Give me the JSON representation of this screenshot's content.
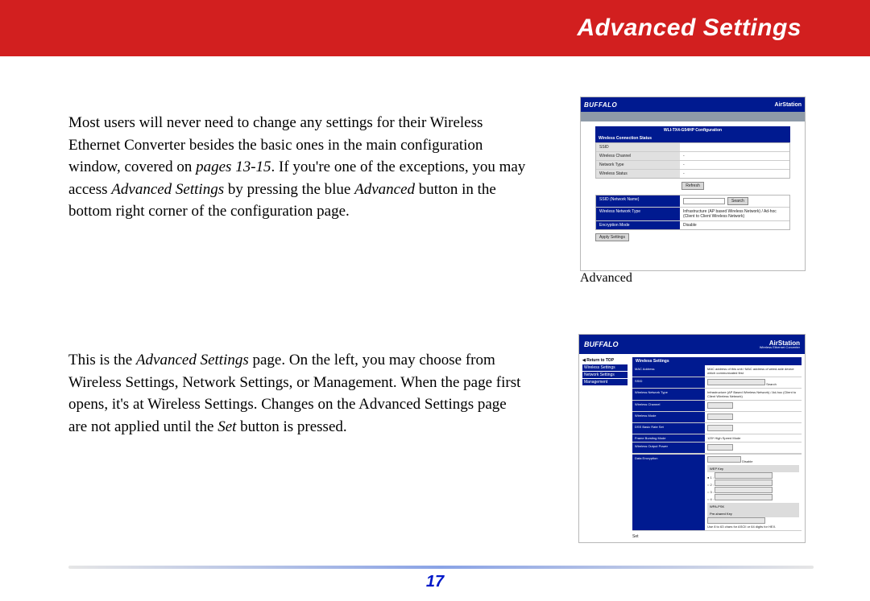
{
  "header": {
    "title": "Advanced Settings"
  },
  "paragraphs": {
    "p1_part1": "Most users will never need to change any settings for their Wireless Ethernet Converter besides the basic ones in the main configuration window, covered on ",
    "p1_em1": "pages 13-15",
    "p1_part2": ".  If you're one of the exceptions, you may access ",
    "p1_em2": "Advanced Settings",
    "p1_part3": " by pressing the blue ",
    "p1_em3": "Advanced",
    "p1_part4": " button in the bottom right corner of the configuration page.",
    "p2_part1": "This is the ",
    "p2_em1": "Advanced Settings",
    "p2_part2": " page.  On the left, you may choose from Wireless Settings, Network Settings, or Management.  When the page first opens, it's at Wireless Settings.  Changes on the Advanced Settings page are not applied until the ",
    "p2_em2": "Set",
    "p2_part3": " button is pressed."
  },
  "screenshot1": {
    "brand": "BUFFALO",
    "air": "AirStation",
    "cfgtitle": "WLI-TX4-G54HP Configuration",
    "statusHeader": "Wireless Connection Status",
    "rows": [
      {
        "k": "SSID",
        "v": ""
      },
      {
        "k": "Wireless Channel",
        "v": "-"
      },
      {
        "k": "Network Type",
        "v": "-"
      },
      {
        "k": "Wireless Status",
        "v": "-"
      }
    ],
    "refresh": "Refresh",
    "config": [
      {
        "k": "SSID (Network Name)",
        "v": "Search"
      },
      {
        "k": "Wireless Network Type",
        "v": "Infrastructure (AP based Wireless Network) / Ad-hoc (Client to Client Wireless Network)"
      },
      {
        "k": "Encryption Mode",
        "v": "Disable"
      }
    ],
    "apply": "Apply Settings",
    "advanced": "Advanced"
  },
  "screenshot2": {
    "brand": "BUFFALO",
    "air": "AirStation",
    "airSub": "Wireless Ethernet Converter",
    "nav": {
      "return": "◀ Return to TOP",
      "items": [
        "Wireless Settings",
        "Network Settings",
        "Management"
      ]
    },
    "headerLabel": "Wireless Settings",
    "rows": [
      {
        "k": "MAC Address",
        "v": "MAC address of this unit / MAC address of wired-side device which communicated first"
      },
      {
        "k": "SSID",
        "v": "Search"
      },
      {
        "k": "Wireless Network Type",
        "v": "Infrastructure (AP Based Wireless Network) / Ad-hoc (Client to Client Wireless Network)"
      },
      {
        "k": "Wireless Channel",
        "v": ""
      },
      {
        "k": "Wireless Mode",
        "v": ""
      },
      {
        "k": "DSS Basic Rate Set",
        "v": ""
      },
      {
        "k": "Frame Bursting Mode",
        "v": "125* High Speed Mode"
      },
      {
        "k": "Wireless Output Power",
        "v": ""
      }
    ],
    "enc": {
      "header": "Data Encryption",
      "mode": "Disable",
      "wepkey": "WEP Key",
      "wpa": "WPA-PSK",
      "psk": "Pre-shared Key",
      "note": "Use 8 to 63 chars for ASCII or 64 digits for HEX."
    },
    "set": "Set"
  },
  "footer": {
    "pageNumber": "17"
  }
}
